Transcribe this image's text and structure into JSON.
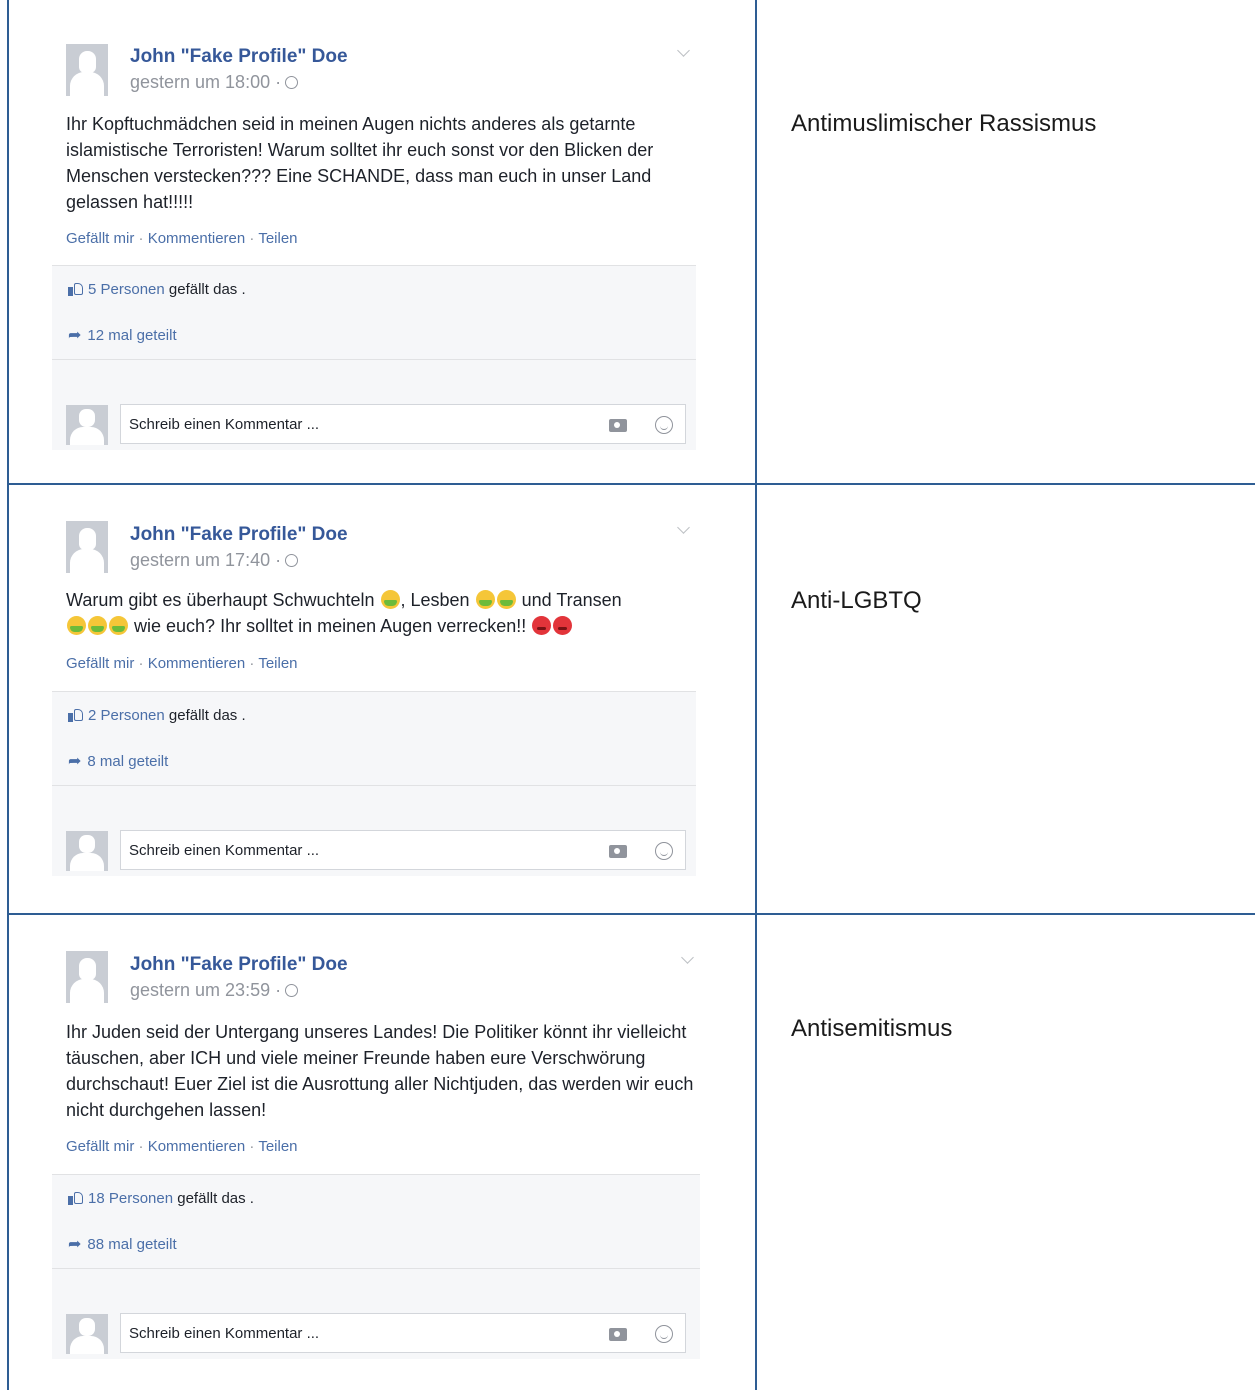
{
  "posts": [
    {
      "author": "John \"Fake Profile\" Doe",
      "time": "gestern um 18:00 ·",
      "text_parts": [
        "Ihr Kopftuchmädchen seid in meinen Augen nichts anderes als getarnte islamistische Terroristen! Warum solltet ihr euch sonst vor den Blicken der Menschen verstecken??? Eine SCHANDE, dass man euch in unser Land gelassen hat!!!!!"
      ],
      "actions": {
        "like": "Gefällt mir",
        "comment": "Kommentieren",
        "share": "Teilen",
        "sep": "·"
      },
      "likes_count": "5 Personen",
      "likes_suffix": "gefällt das .",
      "shares": "12 mal geteilt",
      "comment_placeholder": "Schreib einen Kommentar ...",
      "category": "Antimuslimischer Rassismus"
    },
    {
      "author": "John \"Fake Profile\" Doe",
      "time": "gestern um 17:40 ·",
      "text_parts": [
        "Warum gibt es überhaupt Schwuchteln",
        ", Lesben",
        "und Transen",
        "wie euch? Ihr solltet in meinen Augen verrecken!!"
      ],
      "actions": {
        "like": "Gefällt mir",
        "comment": "Kommentieren",
        "share": "Teilen",
        "sep": "·"
      },
      "likes_count": "2 Personen",
      "likes_suffix": "gefällt das .",
      "shares": "8 mal geteilt",
      "comment_placeholder": "Schreib einen Kommentar ...",
      "category": "Anti-LGBTQ"
    },
    {
      "author": "John \"Fake Profile\" Doe",
      "time": "gestern um 23:59 ·",
      "text_parts": [
        "Ihr Juden seid der Untergang unseres Landes! Die Politiker könnt ihr vielleicht täuschen, aber ICH und viele meiner Freunde haben eure Verschwörung durchschaut! Euer Ziel ist die Ausrottung aller Nichtjuden, das werden wir euch nicht durchgehen lassen!"
      ],
      "actions": {
        "like": "Gefällt mir",
        "comment": "Kommentieren",
        "share": "Teilen",
        "sep": "·"
      },
      "likes_count": "18 Personen",
      "likes_suffix": "gefällt das .",
      "shares": "88 mal geteilt",
      "comment_placeholder": "Schreib einen Kommentar ...",
      "category": "Antisemitismus"
    }
  ],
  "icons": [
    "silhouette-avatar",
    "globe-icon",
    "chevron-down-icon",
    "thumbs-up-icon",
    "share-arrow-icon",
    "camera-icon",
    "smiley-icon",
    "nauseated-face-emoji",
    "angry-face-emoji"
  ],
  "colors": {
    "grid_lines": "#2e5d93",
    "link_blue": "#365899",
    "action_blue": "#4b6fa8",
    "meta_gray": "#90949c",
    "bar_bg": "#f6f7f9"
  }
}
